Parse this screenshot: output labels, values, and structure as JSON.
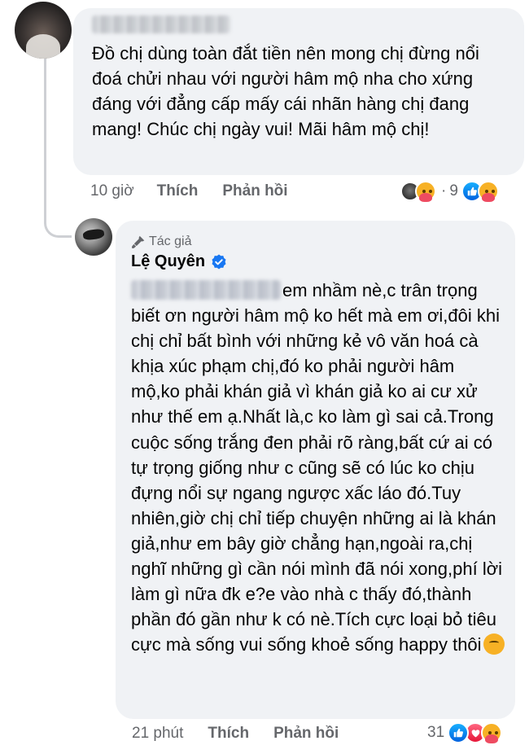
{
  "comment": {
    "text": "Đồ chị dùng toàn đắt tiền nên mong chị đừng nổi đoá chửi nhau với người hâm mộ nha cho xứng đáng với đẳng cấp mấy cái nhãn hàng chị đang mang! Chúc chị ngày vui! Mãi hâm mộ chị!",
    "time": "10 giờ",
    "like_label": "Thích",
    "reply_label": "Phản hồi",
    "reaction_count": "9",
    "reaction_separator": "·"
  },
  "reply": {
    "badge": "Tác giả",
    "author": "Lệ Quyên",
    "text": "em nhầm nè,c trân trọng biết ơn người hâm mộ ko hết mà em ơi,đôi khi chị chỉ bất bình với những kẻ vô văn hoá cà khịa xúc phạm chị,đó ko phải người hâm mộ,ko phải khán giả vì khán giả ko ai cư xử như thế em ạ.Nhất là,c ko làm gì sai cả.Trong cuộc sống trắng đen phải rõ ràng,bất cứ ai có tự trọng giống như c cũng sẽ có lúc ko chịu đựng nổi sự ngang ngược xấc láo đó.Tuy nhiên,giờ chị chỉ tiếp chuyện những ai là khán giả,như em bây giờ chẳng hạn,ngoài ra,chị nghĩ những gì cần nói mình đã nói xong,phí lời làm gì nữa đk e?e vào nhà c thấy đó,thành phần đó gần như k có nè.Tích cực loại bỏ tiêu cực mà sống vui sống khoẻ sống happy thôi",
    "time": "21 phút",
    "like_label": "Thích",
    "reply_label": "Phản hồi",
    "reaction_count": "31"
  },
  "colors": {
    "bubble": "#f0f2f5",
    "meta_text": "#65676b",
    "verified": "#1877f2",
    "like": "#0866ff",
    "love": "#e61739",
    "care": "#f7b125"
  },
  "icons": [
    "commenter-avatar",
    "author-avatar",
    "mic-icon",
    "verified-icon",
    "like-reaction-icon",
    "love-reaction-icon",
    "care-reaction-icon",
    "smiling-hearts-emoji"
  ]
}
